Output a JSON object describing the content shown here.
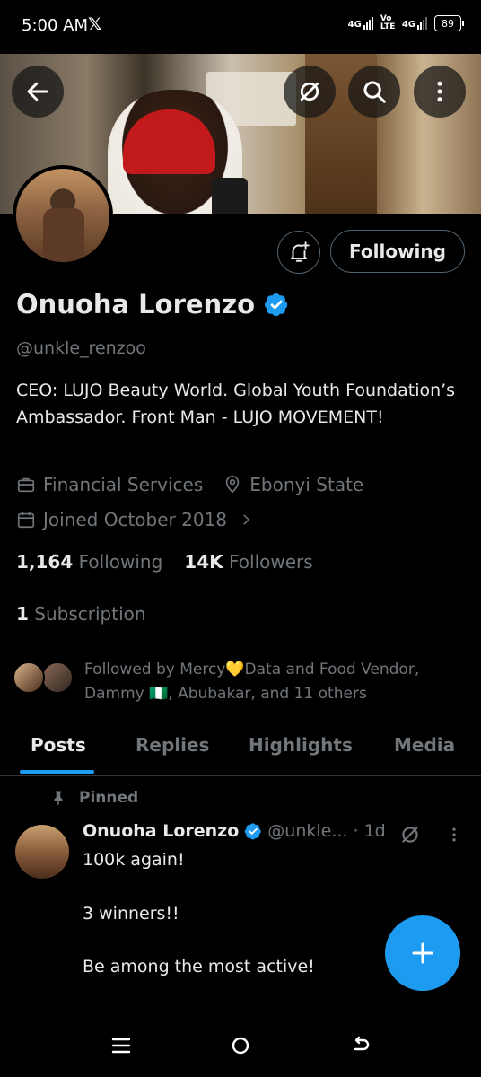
{
  "status_bar": {
    "time": "5:00 AM",
    "x_logo": "𝕏",
    "signal1_label": "4G",
    "volte_label": "Vo LTE",
    "signal2_label": "4G",
    "battery": "89"
  },
  "header": {
    "back_icon": "arrow-left-icon",
    "grok_icon": "grok-icon",
    "search_icon": "search-icon",
    "more_icon": "more-vertical-icon"
  },
  "profile": {
    "notify_icon": "bell-plus-icon",
    "following_label": "Following",
    "name": "Onuoha Lorenzo",
    "handle": "@unkle_renzoo",
    "bio": "CEO: LUJO Beauty World. Global Youth Foundation’s Ambassador. Front Man - LUJO MOVEMENT!",
    "category": "Financial Services",
    "location": "Ebonyi State",
    "joined": "Joined October 2018",
    "following_count": "1,164",
    "following_label_text": "Following",
    "followers_count": "14K",
    "followers_label_text": "Followers",
    "subscription_count": "1",
    "subscription_label": "Subscription",
    "followed_by": "Followed by Mercy💛Data and Food Vendor, Dammy 🇳🇬, Abubakar, and 11 others"
  },
  "tabs": [
    "Posts",
    "Replies",
    "Highlights",
    "Media"
  ],
  "active_tab": "Posts",
  "post": {
    "pinned_label": "Pinned",
    "author": "Onuoha Lorenzo",
    "handle_time": "@unkle... · 1d",
    "lines": [
      "100k again!",
      "3 winners!!",
      "Be among the most active!"
    ]
  },
  "colors": {
    "accent": "#1d9bf0",
    "background": "#000000",
    "text_primary": "#e7e9ea",
    "text_secondary": "#71767b"
  }
}
